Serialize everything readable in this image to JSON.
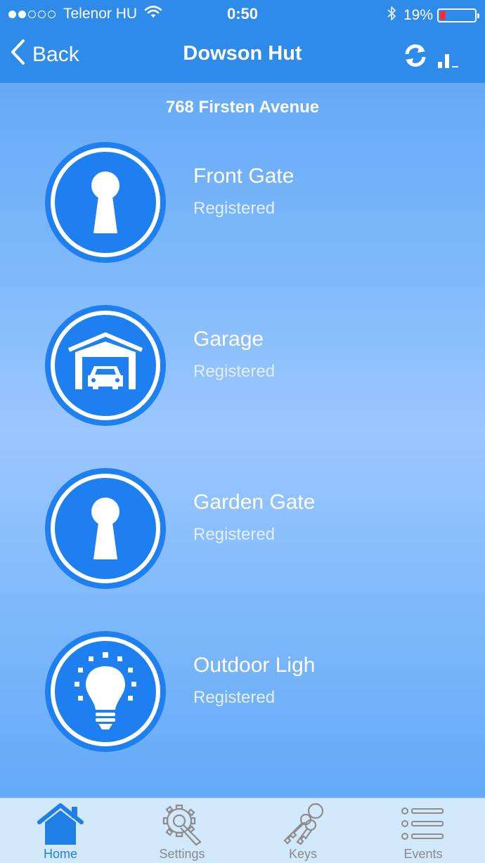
{
  "status_bar": {
    "carrier": "Telenor HU",
    "time": "0:50",
    "battery": "19%",
    "signal_bars": 2,
    "battery_level": 0.19
  },
  "nav": {
    "back_label": "Back",
    "title": "Dowson Hut",
    "refresh_icon": "refresh-icon",
    "signal_icon": "bar-chart-icon"
  },
  "address": "768 Firsten Avenue",
  "devices": [
    {
      "name": "Front Gate",
      "status": "Registered",
      "icon": "keyhole-icon"
    },
    {
      "name": "Garage",
      "status": "Registered",
      "icon": "garage-icon"
    },
    {
      "name": "Garden Gate",
      "status": "Registered",
      "icon": "keyhole-icon"
    },
    {
      "name": "Outdoor Ligh",
      "status": "Registered",
      "icon": "lightbulb-icon"
    }
  ],
  "tabs": [
    {
      "label": "Home",
      "icon": "home-icon",
      "active": true
    },
    {
      "label": "Settings",
      "icon": "settings-gear-icon",
      "active": false
    },
    {
      "label": "Keys",
      "icon": "keys-icon",
      "active": false
    },
    {
      "label": "Events",
      "icon": "list-icon",
      "active": false
    }
  ],
  "colors": {
    "nav_bar": "#2f8bea",
    "accent": "#1f7fe4",
    "circle_fill": "#1d7ff0",
    "tab_bar": "#d2e8fb",
    "battery_low": "#ff2d2d"
  }
}
